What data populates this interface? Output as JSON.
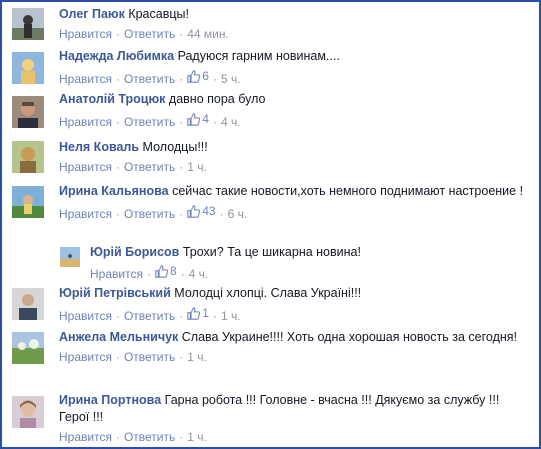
{
  "actions": {
    "like": "Нравится",
    "reply": "Ответить",
    "dot": "·"
  },
  "comments": [
    {
      "author": "Олег Паюк",
      "text": "Красавцы!",
      "likes": "",
      "time": "44 мин."
    },
    {
      "author": "Надежда Любимка",
      "text": "Радуюся гарним новинам....",
      "likes": "6",
      "time": "5 ч."
    },
    {
      "author": "Анатолій Троцюк",
      "text": "давно пора було",
      "likes": "4",
      "time": "4 ч."
    },
    {
      "author": "Неля Коваль",
      "text": "Молодцы!!!",
      "likes": "",
      "time": "1 ч."
    },
    {
      "author": "Ирина Кальянова",
      "text": "сейчас такие новости,хоть немного поднимают настроение !",
      "likes": "43",
      "time": "6 ч."
    },
    {
      "author": "Юрій Борисов",
      "text": "Трохи? Та це шикарна новина!",
      "likes": "8",
      "time": "4 ч."
    },
    {
      "author": "Юрій Петрівський",
      "text": "Молодці хлопці. Слава Україні!!!",
      "likes": "1",
      "time": "1 ч."
    },
    {
      "author": "Анжела Мельничук",
      "text": "Слава Украине!!!! Хоть одна хорошая новость за сегодня!",
      "likes": "",
      "time": "1 ч."
    },
    {
      "author": "Ирина Портнова",
      "text": "Гарна робота !!! Головне - вчасна !!! Дякуємо за службу !!! Герої !!!",
      "likes": "",
      "time": "1 ч."
    }
  ],
  "colors": {
    "link": "#3b5998",
    "meta": "#90949c",
    "action": "#6d84b4",
    "frame": "#2b4fa8"
  }
}
